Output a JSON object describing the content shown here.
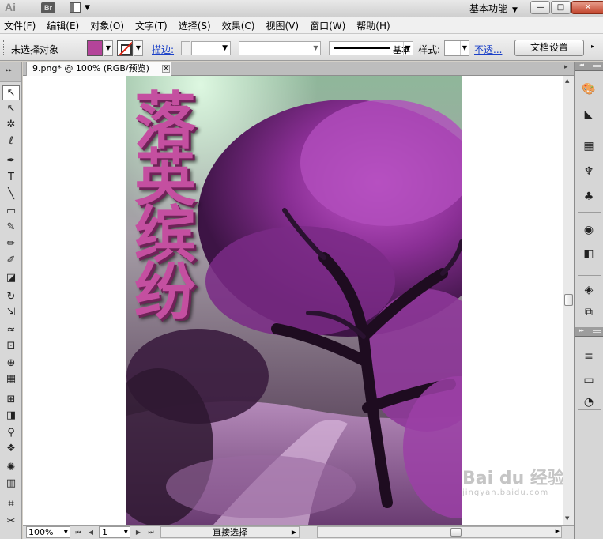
{
  "app": {
    "logo": "Ai",
    "bridge_logo": "Br",
    "workspace": "基本功能",
    "window_buttons": {
      "minimize": "—",
      "maximize": "□",
      "close": "✕"
    }
  },
  "menu": [
    "文件(F)",
    "编辑(E)",
    "对象(O)",
    "文字(T)",
    "选择(S)",
    "效果(C)",
    "视图(V)",
    "窗口(W)",
    "帮助(H)"
  ],
  "control": {
    "selection_status": "未选择对象",
    "fill_color": "#b4449a",
    "stroke_link": "描边:",
    "brush_label": "基本",
    "style_label": "样式:",
    "opacity_link": "不透...",
    "doc_setup": "文档设置"
  },
  "document": {
    "tab_title": "9.png* @ 100% (RGB/预览)",
    "tab_close": "✕",
    "artwork_title_chars": [
      "落",
      "英",
      "缤",
      "纷"
    ]
  },
  "watermark": {
    "brand": "Bai du 经验",
    "url": "jingyan.baidu.com"
  },
  "status": {
    "zoom": "100%",
    "page": "1",
    "current_tool": "直接选择"
  },
  "tools": [
    {
      "name": "selection-tool",
      "glyph": "↖"
    },
    {
      "name": "direct-selection-tool",
      "glyph": "↖"
    },
    {
      "name": "magic-wand-tool",
      "glyph": "✲"
    },
    {
      "name": "lasso-tool",
      "glyph": "ℓ"
    },
    {
      "name": "pen-tool",
      "glyph": "✒"
    },
    {
      "name": "type-tool",
      "glyph": "T"
    },
    {
      "name": "line-tool",
      "glyph": "╲"
    },
    {
      "name": "rectangle-tool",
      "glyph": "▭"
    },
    {
      "name": "paintbrush-tool",
      "glyph": "✎"
    },
    {
      "name": "pencil-tool",
      "glyph": "✏"
    },
    {
      "name": "blob-brush-tool",
      "glyph": "✐"
    },
    {
      "name": "eraser-tool",
      "glyph": "◪"
    },
    {
      "name": "rotate-tool",
      "glyph": "↻"
    },
    {
      "name": "scale-tool",
      "glyph": "⇲"
    },
    {
      "name": "warp-tool",
      "glyph": "≈"
    },
    {
      "name": "free-transform-tool",
      "glyph": "⊡"
    },
    {
      "name": "shape-builder-tool",
      "glyph": "⊕"
    },
    {
      "name": "perspective-grid-tool",
      "glyph": "▦"
    },
    {
      "name": "mesh-tool",
      "glyph": "⊞"
    },
    {
      "name": "gradient-tool",
      "glyph": "◨"
    },
    {
      "name": "eyedropper-tool",
      "glyph": "⚲"
    },
    {
      "name": "blend-tool",
      "glyph": "❖"
    },
    {
      "name": "symbol-sprayer-tool",
      "glyph": "✺"
    },
    {
      "name": "column-graph-tool",
      "glyph": "▥"
    },
    {
      "name": "artboard-tool",
      "glyph": "⌗"
    },
    {
      "name": "slice-tool",
      "glyph": "✂"
    }
  ],
  "dock": [
    {
      "name": "color-panel-icon",
      "glyph": "🎨"
    },
    {
      "name": "color-guide-panel-icon",
      "glyph": "◣"
    },
    {
      "name": "swatches-panel-icon",
      "glyph": "▦"
    },
    {
      "name": "brushes-panel-icon",
      "glyph": "♆"
    },
    {
      "name": "symbols-panel-icon",
      "glyph": "♣"
    },
    {
      "name": "appearance-panel-icon",
      "glyph": "◉"
    },
    {
      "name": "graphic-styles-panel-icon",
      "glyph": "◧"
    },
    {
      "name": "layers-panel-icon",
      "glyph": "◈"
    },
    {
      "name": "artboards-panel-icon",
      "glyph": "⧉"
    },
    {
      "name": "stroke-panel-icon",
      "glyph": "≡"
    },
    {
      "name": "gradient-panel-icon",
      "glyph": "▭"
    },
    {
      "name": "transparency-panel-icon",
      "glyph": "◔"
    }
  ]
}
